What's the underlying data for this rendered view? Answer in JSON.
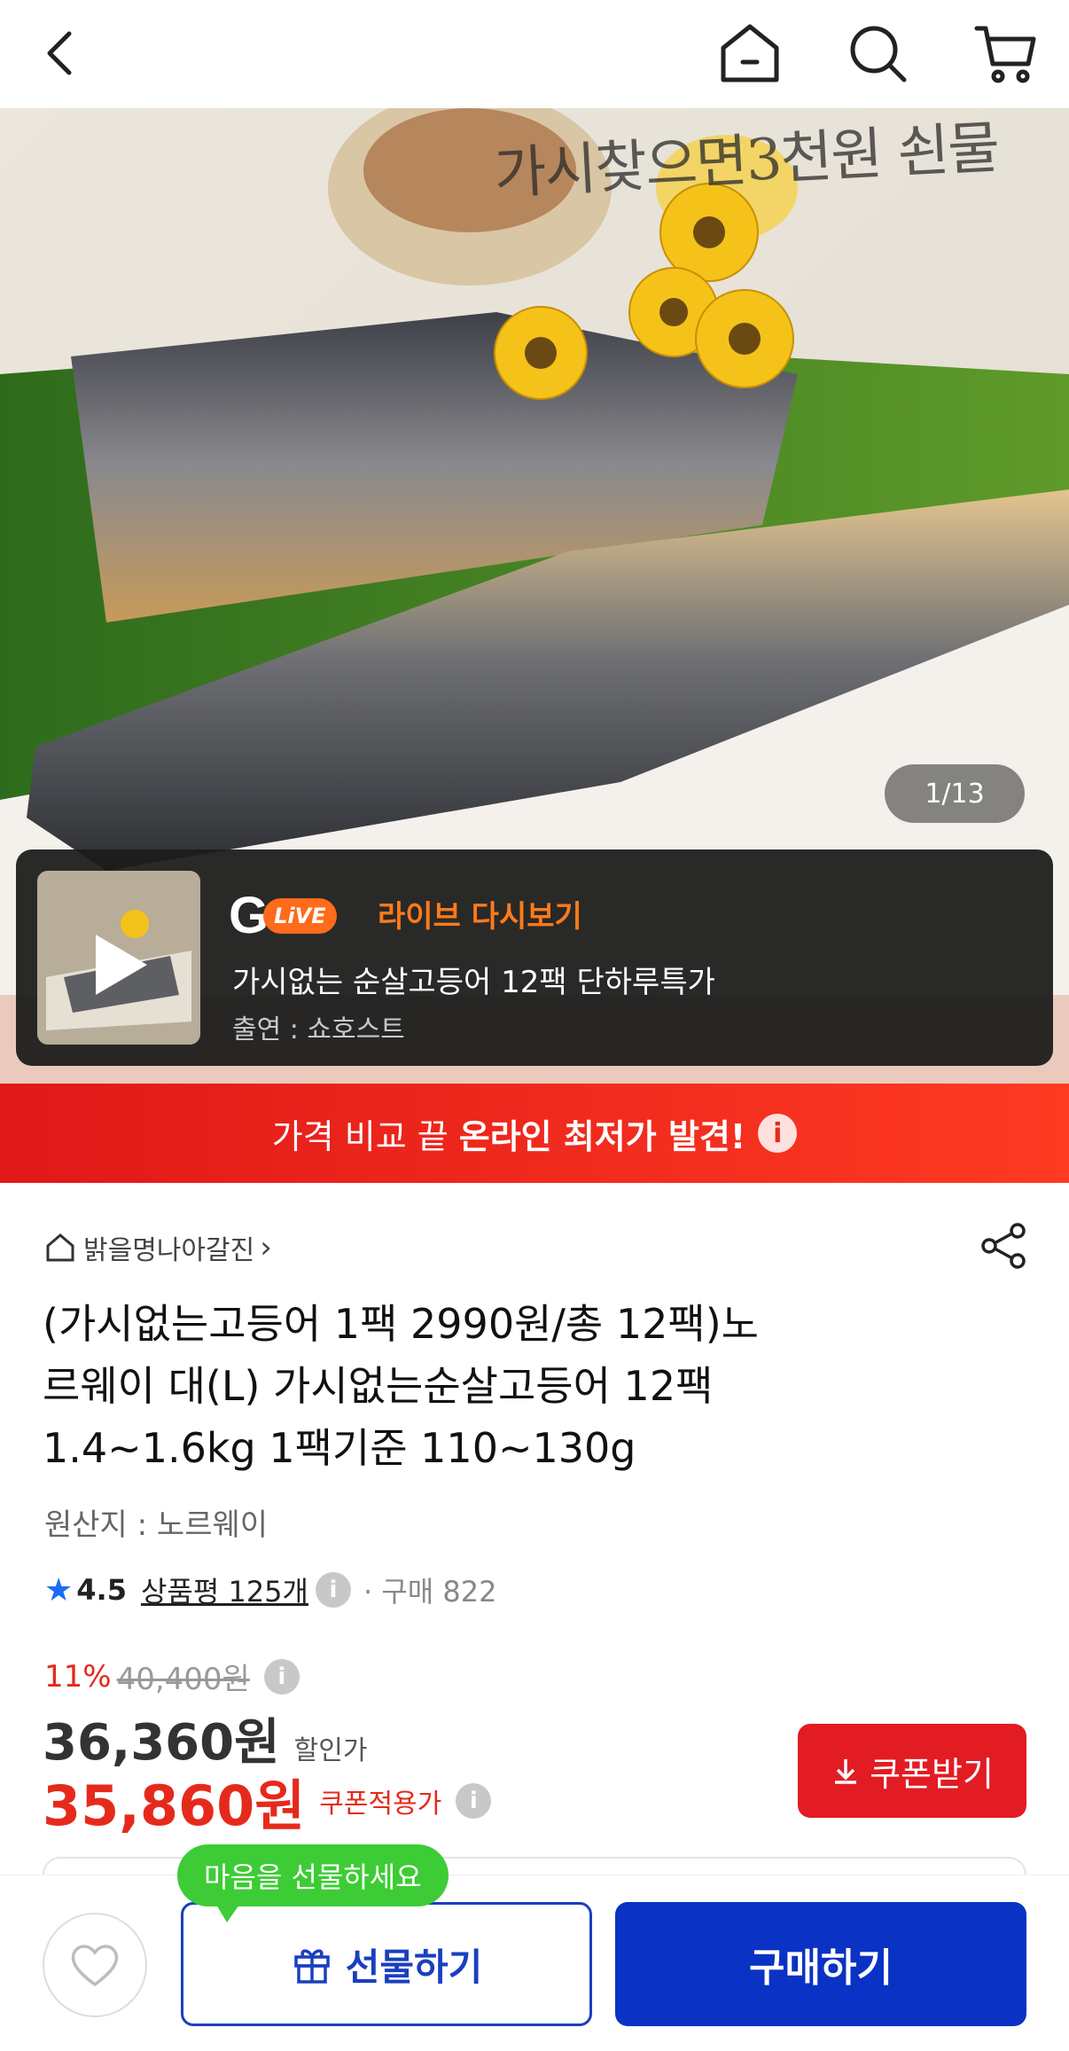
{
  "nav": {
    "back_icon": "chevron-left-icon",
    "home_icon": "home-icon",
    "search_icon": "search-icon",
    "cart_icon": "cart-icon"
  },
  "hero": {
    "caption": "가시찾으면3천원 쇤물",
    "counter": "1/13",
    "live": {
      "logo_letter": "G",
      "logo_badge": "LiVE",
      "replay_label": "라이브 다시보기",
      "title": "가시없는 순살고등어 12팩 단하루특가",
      "host": "출연 : 쇼호스트"
    }
  },
  "promo": {
    "text": "가격 비교 끝",
    "highlight": "온라인 최저가 발견!",
    "info_icon": "i"
  },
  "product": {
    "seller": "밝을명나아갈진",
    "seller_chevron": "›",
    "title_lines": [
      "(가시없는고등어 1팩 2990원/총 12팩)노",
      "르웨이 대(L) 가시없는순살고등어 12팩",
      "1.4~1.6kg 1팩기준 110~130g"
    ],
    "origin": "원산지 : 노르웨이",
    "rating": {
      "star": "★",
      "score": "4.5",
      "review_label": "상품평 125개",
      "info": "i",
      "purchases": "· 구매 822"
    },
    "price": {
      "discount_rate": "11%",
      "original": "40,400원",
      "sale_price": "36,360원",
      "sale_label": "할인가",
      "coupon_price": "35,860원",
      "coupon_label": "쿠폰적용가",
      "info": "i"
    },
    "coupon_button": "쿠폰받기"
  },
  "bottom": {
    "tooltip": "마음을 선물하세요",
    "gift_button": "선물하기",
    "buy_button": "구매하기"
  },
  "colors": {
    "accent_red": "#e31b23",
    "accent_blue": "#0a32c4",
    "live_orange": "#ff6b1a",
    "tooltip_green": "#3dcc35",
    "rating_star": "#1a6ef5"
  }
}
